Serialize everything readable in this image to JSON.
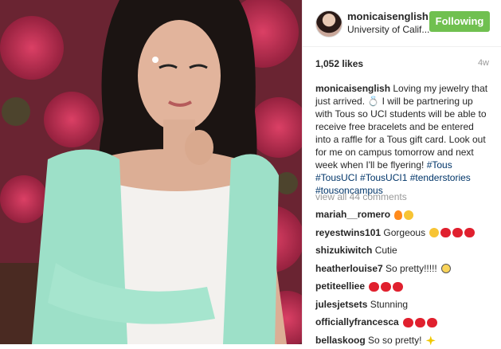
{
  "post": {
    "photo_icon": "portrait-photo",
    "header": {
      "username": "monicaisenglish",
      "location": "University of Calif...",
      "follow_label": "Following"
    },
    "likes": "1,052 likes",
    "age": "4w",
    "caption": {
      "username": "monicaisenglish",
      "text": "Loving my jewelry that just arrived. 💍 I will be partnering up with Tous so UCI students will be able to receive free bracelets and be entered into a raffle for a Tous gift card. Look out for me on campus tomorrow and next week when I'll be flyering!",
      "tags": [
        "#Tous",
        "#TousUCI",
        "#TousUCI1",
        "#tenderstories",
        "#tousoncampus"
      ]
    },
    "view_all": "view all 44 comments",
    "comments": [
      {
        "user": "mariah__romero",
        "text": "",
        "icons": [
          "fire-icon",
          "heart-eyes-icon"
        ]
      },
      {
        "user": "reyestwins101",
        "text": "Gorgeous",
        "icons": [
          "kiss-icon",
          "heart-icon",
          "heart-icon",
          "heart-icon"
        ]
      },
      {
        "user": "shizukiwitch",
        "text": "Cutie",
        "icons": []
      },
      {
        "user": "heatherlouise7",
        "text": "So pretty!!!!!",
        "icons": [
          "scream-icon"
        ]
      },
      {
        "user": "petiteelliee",
        "text": "",
        "icons": [
          "heart-icon",
          "heart-icon",
          "heart-icon"
        ]
      },
      {
        "user": "julesjetsets",
        "text": "Stunning",
        "icons": []
      },
      {
        "user": "officiallyfrancesca",
        "text": "",
        "icons": [
          "heart-icon",
          "heart-icon",
          "heart-icon"
        ]
      },
      {
        "user": "bellaskoog",
        "text": "So so pretty!",
        "icons": [
          "sparkle-icon"
        ]
      }
    ]
  }
}
